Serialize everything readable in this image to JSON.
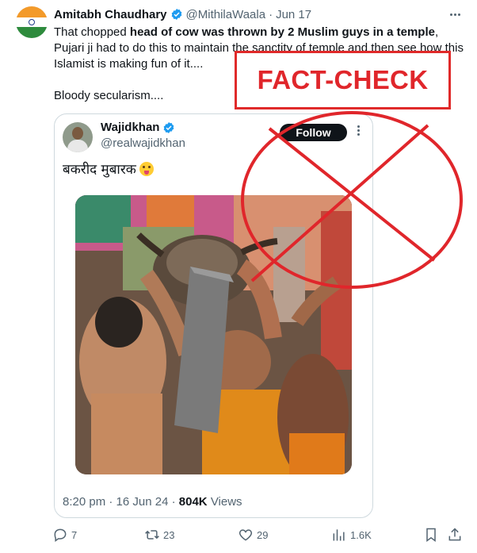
{
  "tweet": {
    "author_name": "Amitabh Chaudhary",
    "handle": "@MithilaWaala",
    "separator": "·",
    "date": "Jun 17",
    "text_part1": "That chopped ",
    "text_bold": "head of cow was thrown by 2 Muslim guys in a temple",
    "text_part2": ", Pujari ji had to do this to maintain the sanctity of temple and then see how this Islamist is making fun of it....",
    "text_line2": "Bloody secularism....",
    "icons": {
      "more": "more-horizontal-icon",
      "verified": "verified-badge-icon"
    }
  },
  "overlay": {
    "fact_check_label": "FACT-CHECK",
    "color": "#e0262b"
  },
  "quoted_tweet": {
    "author_name": "Wajidkhan",
    "handle": "@realwajidkhan",
    "follow_label": "Follow",
    "text": "बकरीद मुबारक",
    "emoji": "tongue-out-face-emoji",
    "time": "8:20 pm",
    "separator": "·",
    "date": "16 Jun 24",
    "separator2": "·",
    "views_count": "804K",
    "views_label": "Views"
  },
  "actions": {
    "replies": "7",
    "reposts": "23",
    "likes": "29",
    "views": "1.6K",
    "icons": [
      "reply-icon",
      "repost-icon",
      "like-icon",
      "views-icon",
      "bookmark-icon",
      "share-icon"
    ]
  },
  "colors": {
    "text": "#0f1419",
    "secondary": "#536471",
    "verified": "#1d9bf0",
    "border": "#cfd9de",
    "fact_check_red": "#e0262b"
  }
}
